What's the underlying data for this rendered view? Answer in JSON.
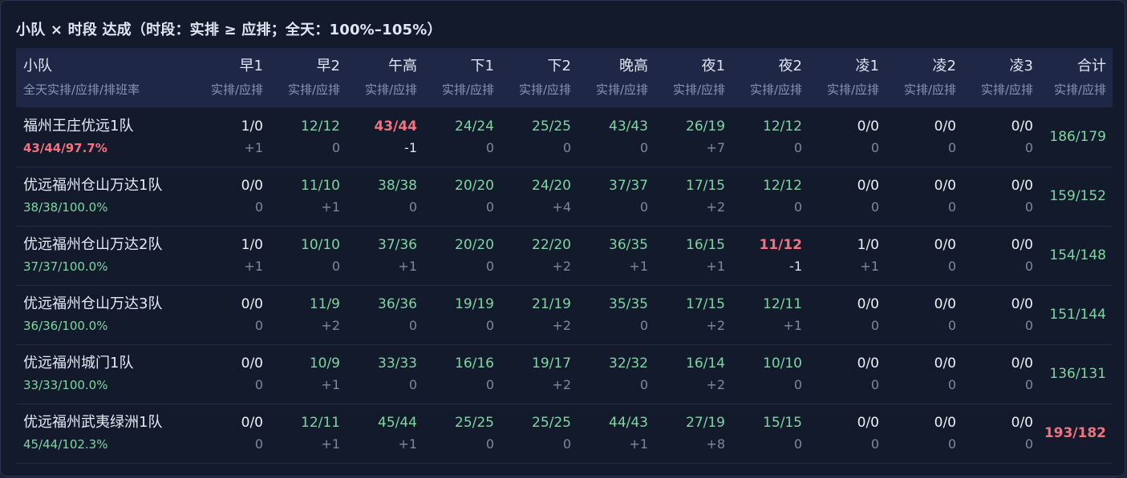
{
  "title": "小队 × 时段 达成（时段：实排 ≥ 应排；全天：100%–105%）",
  "header": {
    "team_label": "小队",
    "team_sub": "全天实排/应排/排班率",
    "slots": [
      "早1",
      "早2",
      "午高",
      "下1",
      "下2",
      "晚高",
      "夜1",
      "夜2",
      "凌1",
      "凌2",
      "凌3"
    ],
    "slot_sub": "实排/应排",
    "total_label": "合计",
    "total_sub": "实排/应排"
  },
  "colors": {
    "ok": "#7fd6a0",
    "bad": "#f2737e",
    "neutral": "#eef1f7"
  },
  "rows": [
    {
      "name": "福州王庄优远1队",
      "summary": "43/44/97.7%",
      "summary_status": "bad",
      "cells": [
        {
          "v": "1/0",
          "d": "+1",
          "s": "neutral"
        },
        {
          "v": "12/12",
          "d": "0",
          "s": "ok"
        },
        {
          "v": "43/44",
          "d": "-1",
          "s": "bad"
        },
        {
          "v": "24/24",
          "d": "0",
          "s": "ok"
        },
        {
          "v": "25/25",
          "d": "0",
          "s": "ok"
        },
        {
          "v": "43/43",
          "d": "0",
          "s": "ok"
        },
        {
          "v": "26/19",
          "d": "+7",
          "s": "ok"
        },
        {
          "v": "12/12",
          "d": "0",
          "s": "ok"
        },
        {
          "v": "0/0",
          "d": "0",
          "s": "neutral"
        },
        {
          "v": "0/0",
          "d": "0",
          "s": "neutral"
        },
        {
          "v": "0/0",
          "d": "0",
          "s": "neutral"
        }
      ],
      "total": "186/179",
      "total_status": "ok"
    },
    {
      "name": "优远福州仓山万达1队",
      "summary": "38/38/100.0%",
      "summary_status": "ok",
      "cells": [
        {
          "v": "0/0",
          "d": "0",
          "s": "neutral"
        },
        {
          "v": "11/10",
          "d": "+1",
          "s": "ok"
        },
        {
          "v": "38/38",
          "d": "0",
          "s": "ok"
        },
        {
          "v": "20/20",
          "d": "0",
          "s": "ok"
        },
        {
          "v": "24/20",
          "d": "+4",
          "s": "ok"
        },
        {
          "v": "37/37",
          "d": "0",
          "s": "ok"
        },
        {
          "v": "17/15",
          "d": "+2",
          "s": "ok"
        },
        {
          "v": "12/12",
          "d": "0",
          "s": "ok"
        },
        {
          "v": "0/0",
          "d": "0",
          "s": "neutral"
        },
        {
          "v": "0/0",
          "d": "0",
          "s": "neutral"
        },
        {
          "v": "0/0",
          "d": "0",
          "s": "neutral"
        }
      ],
      "total": "159/152",
      "total_status": "ok"
    },
    {
      "name": "优远福州仓山万达2队",
      "summary": "37/37/100.0%",
      "summary_status": "ok",
      "cells": [
        {
          "v": "1/0",
          "d": "+1",
          "s": "neutral"
        },
        {
          "v": "10/10",
          "d": "0",
          "s": "ok"
        },
        {
          "v": "37/36",
          "d": "+1",
          "s": "ok"
        },
        {
          "v": "20/20",
          "d": "0",
          "s": "ok"
        },
        {
          "v": "22/20",
          "d": "+2",
          "s": "ok"
        },
        {
          "v": "36/35",
          "d": "+1",
          "s": "ok"
        },
        {
          "v": "16/15",
          "d": "+1",
          "s": "ok"
        },
        {
          "v": "11/12",
          "d": "-1",
          "s": "bad"
        },
        {
          "v": "1/0",
          "d": "+1",
          "s": "neutral"
        },
        {
          "v": "0/0",
          "d": "0",
          "s": "neutral"
        },
        {
          "v": "0/0",
          "d": "0",
          "s": "neutral"
        }
      ],
      "total": "154/148",
      "total_status": "ok"
    },
    {
      "name": "优远福州仓山万达3队",
      "summary": "36/36/100.0%",
      "summary_status": "ok",
      "cells": [
        {
          "v": "0/0",
          "d": "0",
          "s": "neutral"
        },
        {
          "v": "11/9",
          "d": "+2",
          "s": "ok"
        },
        {
          "v": "36/36",
          "d": "0",
          "s": "ok"
        },
        {
          "v": "19/19",
          "d": "0",
          "s": "ok"
        },
        {
          "v": "21/19",
          "d": "+2",
          "s": "ok"
        },
        {
          "v": "35/35",
          "d": "0",
          "s": "ok"
        },
        {
          "v": "17/15",
          "d": "+2",
          "s": "ok"
        },
        {
          "v": "12/11",
          "d": "+1",
          "s": "ok"
        },
        {
          "v": "0/0",
          "d": "0",
          "s": "neutral"
        },
        {
          "v": "0/0",
          "d": "0",
          "s": "neutral"
        },
        {
          "v": "0/0",
          "d": "0",
          "s": "neutral"
        }
      ],
      "total": "151/144",
      "total_status": "ok"
    },
    {
      "name": "优远福州城门1队",
      "summary": "33/33/100.0%",
      "summary_status": "ok",
      "cells": [
        {
          "v": "0/0",
          "d": "0",
          "s": "neutral"
        },
        {
          "v": "10/9",
          "d": "+1",
          "s": "ok"
        },
        {
          "v": "33/33",
          "d": "0",
          "s": "ok"
        },
        {
          "v": "16/16",
          "d": "0",
          "s": "ok"
        },
        {
          "v": "19/17",
          "d": "+2",
          "s": "ok"
        },
        {
          "v": "32/32",
          "d": "0",
          "s": "ok"
        },
        {
          "v": "16/14",
          "d": "+2",
          "s": "ok"
        },
        {
          "v": "10/10",
          "d": "0",
          "s": "ok"
        },
        {
          "v": "0/0",
          "d": "0",
          "s": "neutral"
        },
        {
          "v": "0/0",
          "d": "0",
          "s": "neutral"
        },
        {
          "v": "0/0",
          "d": "0",
          "s": "neutral"
        }
      ],
      "total": "136/131",
      "total_status": "ok"
    },
    {
      "name": "优远福州武夷绿洲1队",
      "summary": "45/44/102.3%",
      "summary_status": "ok",
      "cells": [
        {
          "v": "0/0",
          "d": "0",
          "s": "neutral"
        },
        {
          "v": "12/11",
          "d": "+1",
          "s": "ok"
        },
        {
          "v": "45/44",
          "d": "+1",
          "s": "ok"
        },
        {
          "v": "25/25",
          "d": "0",
          "s": "ok"
        },
        {
          "v": "25/25",
          "d": "0",
          "s": "ok"
        },
        {
          "v": "44/43",
          "d": "+1",
          "s": "ok"
        },
        {
          "v": "27/19",
          "d": "+8",
          "s": "ok"
        },
        {
          "v": "15/15",
          "d": "0",
          "s": "ok"
        },
        {
          "v": "0/0",
          "d": "0",
          "s": "neutral"
        },
        {
          "v": "0/0",
          "d": "0",
          "s": "neutral"
        },
        {
          "v": "0/0",
          "d": "0",
          "s": "neutral"
        }
      ],
      "total": "193/182",
      "total_status": "bad"
    }
  ]
}
